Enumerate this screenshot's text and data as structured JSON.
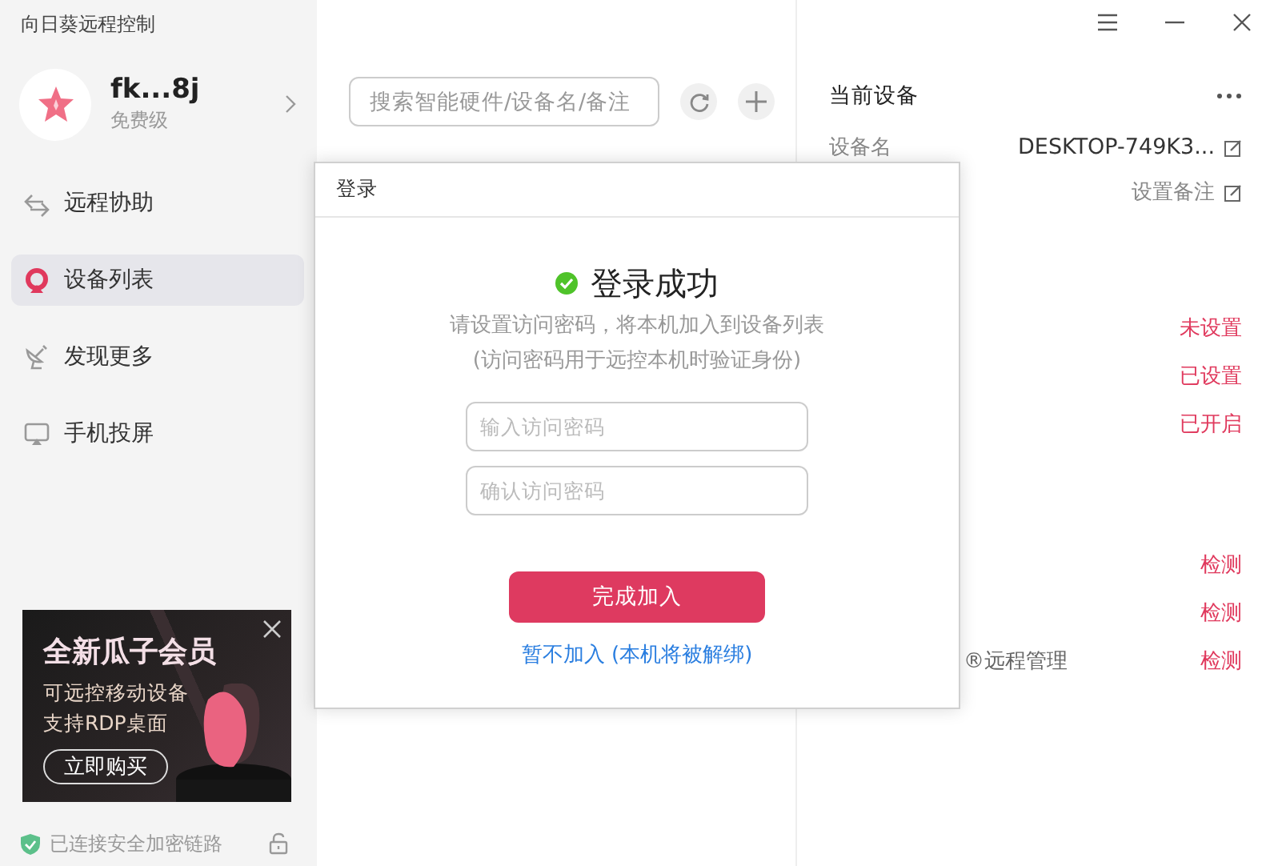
{
  "app_title": "向日葵远程控制",
  "window_controls": [
    {
      "kind": "menu"
    },
    {
      "kind": "minimize"
    },
    {
      "kind": "close"
    }
  ],
  "account": {
    "name": "fk...8j",
    "tier": "免费级"
  },
  "nav": [
    {
      "label": "远程协助",
      "kind": "assist",
      "selected": false
    },
    {
      "label": "设备列表",
      "kind": "devices",
      "selected": true
    },
    {
      "label": "发现更多",
      "kind": "discover",
      "selected": false
    },
    {
      "label": "手机投屏",
      "kind": "cast",
      "selected": false
    }
  ],
  "promo": {
    "title": "全新瓜子会员",
    "lines": [
      "可远控移动设备",
      "支持RDP桌面"
    ],
    "button": "立即购买"
  },
  "status": "已连接安全加密链路",
  "search": {
    "placeholder": "搜索智能硬件/设备名/备注"
  },
  "device": {
    "title": "当前设备",
    "name_label": "设备名",
    "name": "DESKTOP-749K3...",
    "note": "设置备注",
    "settings": [
      {
        "value": "未设置"
      },
      {
        "value": "已设置"
      },
      {
        "value": "已开启"
      }
    ],
    "checks": [
      {
        "value": "检测"
      },
      {
        "value": "检测"
      },
      {
        "label": "®远程管理",
        "value": "检测"
      }
    ]
  },
  "dialog": {
    "title": "登录",
    "heading": "登录成功",
    "lines": [
      "请设置访问密码，将本机加入到设备列表",
      "(访问密码用于远控本机时验证身份)"
    ],
    "fields": [
      {
        "placeholder": "输入访问密码"
      },
      {
        "placeholder": "确认访问密码"
      }
    ],
    "submit": "完成加入",
    "skip": "暂不加入 (本机将被解绑)"
  }
}
